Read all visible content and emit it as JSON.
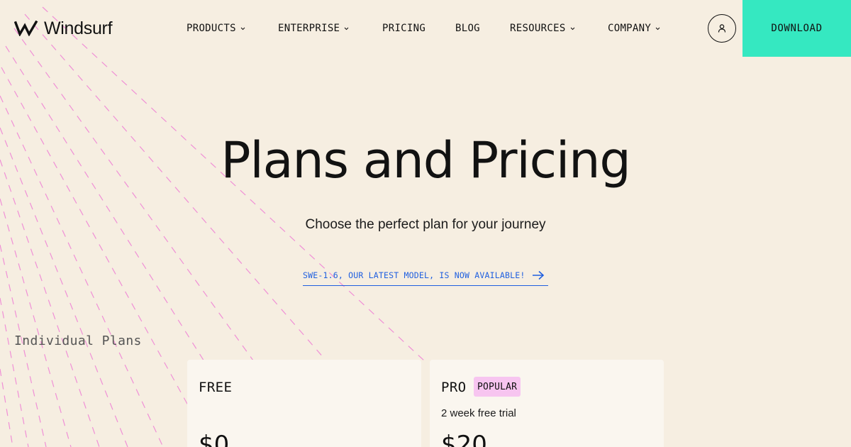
{
  "header": {
    "logo_text": "Windsurf",
    "nav": [
      {
        "label": "PRODUCTS",
        "has_dropdown": true
      },
      {
        "label": "ENTERPRISE",
        "has_dropdown": true
      },
      {
        "label": "PRICING",
        "has_dropdown": false
      },
      {
        "label": "BLOG",
        "has_dropdown": false
      },
      {
        "label": "RESOURCES",
        "has_dropdown": true
      },
      {
        "label": "COMPANY",
        "has_dropdown": true
      }
    ],
    "account_icon": "user-icon",
    "download_label": "DOWNLOAD"
  },
  "hero": {
    "title": "Plans and Pricing",
    "subtitle": "Choose the perfect plan for your journey",
    "announcement": "SWE-1.6, OUR LATEST MODEL, IS NOW AVAILABLE!"
  },
  "section_label": "Individual Plans",
  "plans": [
    {
      "name": "FREE",
      "badge": "",
      "trial": "",
      "price": "$0"
    },
    {
      "name": "PRO",
      "badge": "POPULAR",
      "trial": "2 week free trial",
      "price": "$20"
    }
  ],
  "colors": {
    "background": "#f6eee1",
    "download_bg": "#35e8c1",
    "link_blue": "#1f5fe0",
    "badge_pink": "#f7c5f0",
    "card_bg": "#faf6ef",
    "decor_lines": "#f08fd6"
  }
}
